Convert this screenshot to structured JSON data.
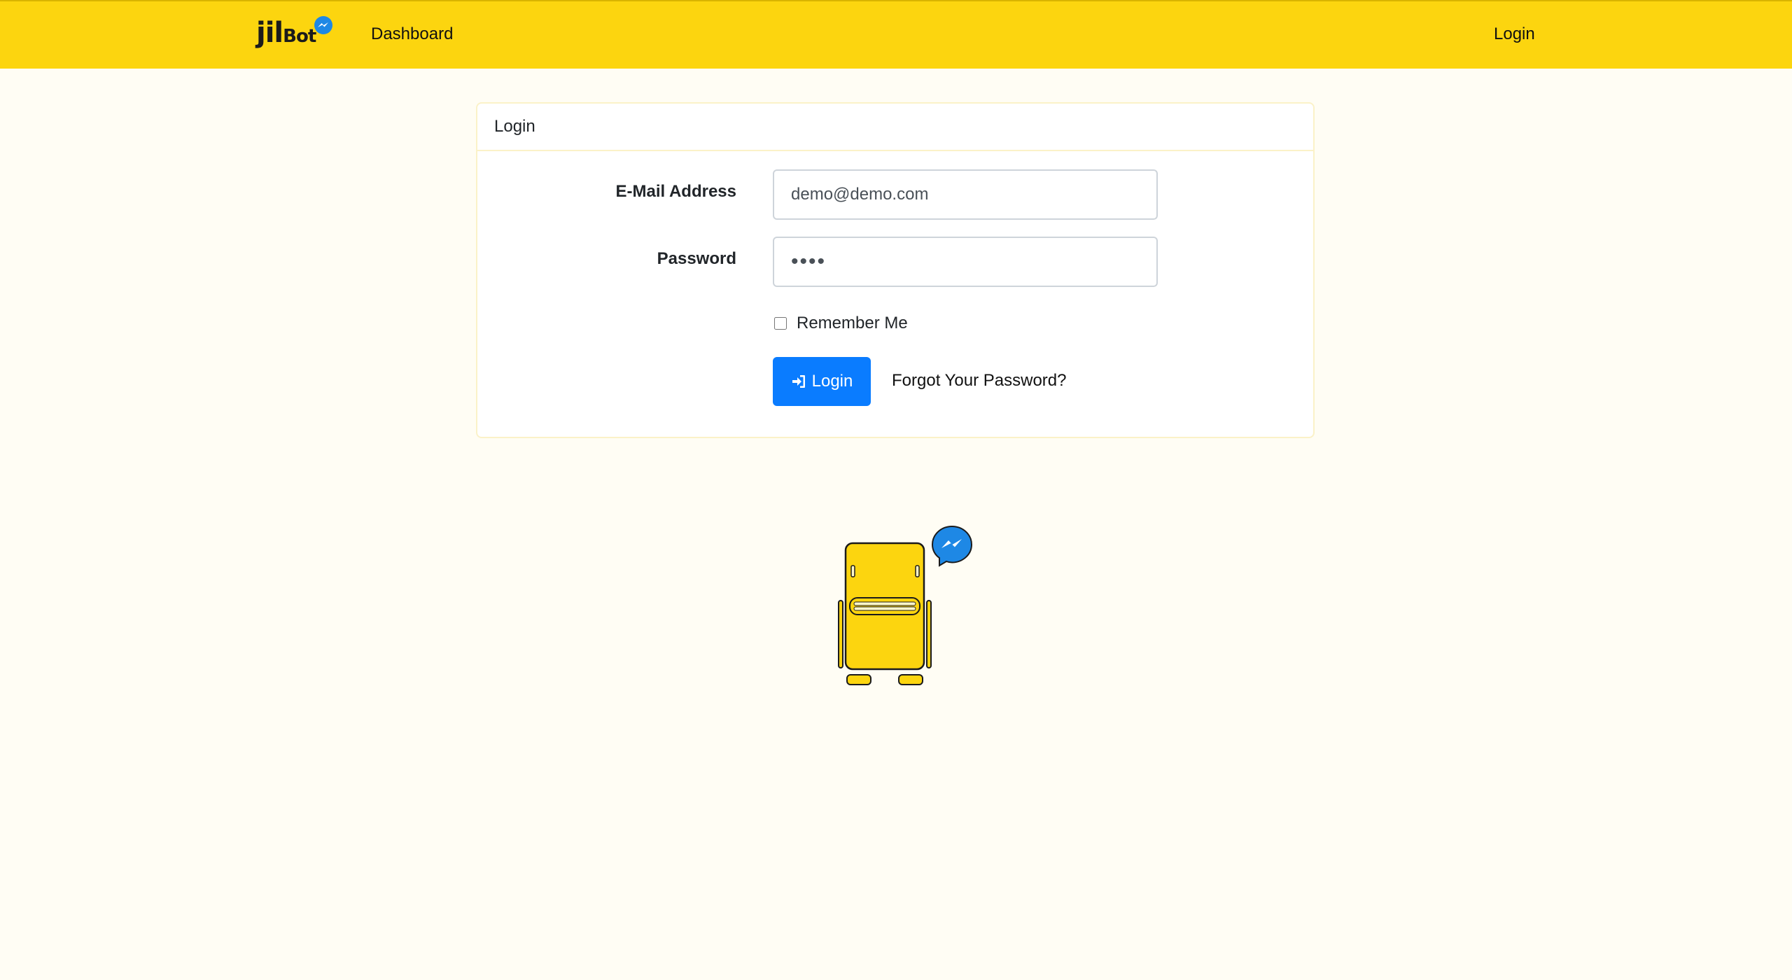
{
  "navbar": {
    "brand_text_main": "jil",
    "brand_text_sub": "Bot",
    "links": {
      "dashboard": "Dashboard",
      "login": "Login"
    }
  },
  "card": {
    "header": "Login",
    "email_label": "E-Mail Address",
    "email_value": "demo@demo.com",
    "password_label": "Password",
    "password_value": "demo",
    "remember_label": "Remember Me",
    "remember_checked": false,
    "login_button": "Login",
    "forgot_link": "Forgot Your Password?"
  },
  "icons": {
    "brand_badge": "messenger-icon",
    "login_button_icon": "sign-in-icon",
    "illustration": "robot-illustration",
    "illustration_badge": "messenger-icon"
  },
  "colors": {
    "navbar": "#fcd50f",
    "page_background": "#fffdf4",
    "primary_button": "#0a7cff",
    "messenger_blue": "#1e88e5",
    "robot_yellow": "#fcd50f"
  }
}
